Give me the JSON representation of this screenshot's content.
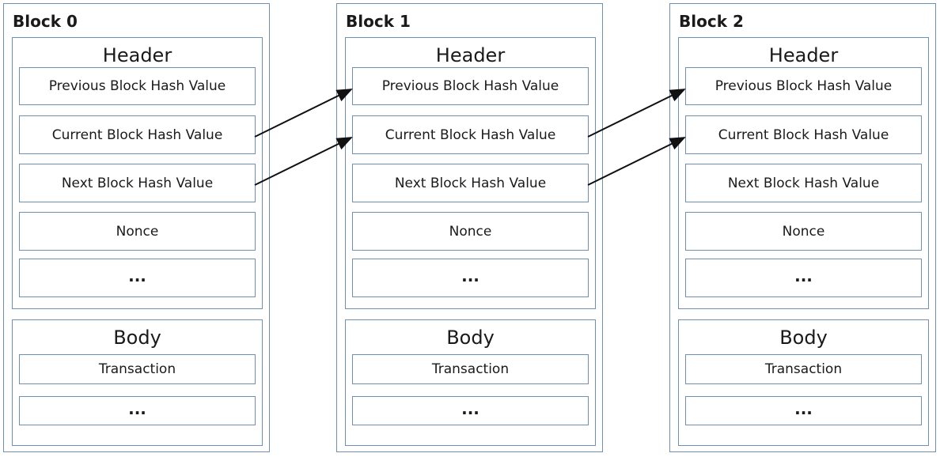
{
  "blocks": [
    {
      "title": "Block 0"
    },
    {
      "title": "Block 1"
    },
    {
      "title": "Block 2"
    }
  ],
  "header": {
    "title": "Header",
    "items": [
      "Previous Block Hash Value",
      "Current Block Hash Value",
      "Next Block Hash Value",
      "Nonce",
      "..."
    ]
  },
  "body": {
    "title": "Body",
    "items": [
      "Transaction",
      "..."
    ]
  },
  "colors": {
    "border": "#6f8fb3",
    "arrow": "#111111"
  }
}
